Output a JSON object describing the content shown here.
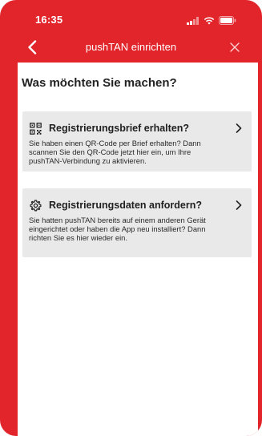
{
  "status_bar": {
    "time": "16:35",
    "icons": [
      "signal-icon",
      "wifi-icon",
      "battery-icon"
    ]
  },
  "nav": {
    "title": "pushTAN einrichten",
    "back_icon": "chevron-left-icon",
    "close_icon": "close-icon"
  },
  "main": {
    "heading": "Was möchten Sie machen?",
    "options": [
      {
        "icon": "qr-code-icon",
        "title": "Registrierungsbrief erhalten?",
        "lines": [
          "Sie haben einen QR-Code per Brief erhalten? Dann",
          "scannen Sie den QR-Code jetzt hier ein, um Ihre",
          "pushTAN-Verbindung zu aktivieren."
        ],
        "chevron": "chevron-right-icon"
      },
      {
        "icon": "gear-icon",
        "title": "Registrierungsdaten anfordern?",
        "lines": [
          "Sie hatten pushTAN bereits auf einem anderen Gerät",
          "eingerichtet oder haben die App neu installiert? Dann",
          "richten Sie es hier wieder ein."
        ],
        "chevron": "chevron-right-icon"
      }
    ]
  },
  "colors": {
    "brand_red": "#e2242b",
    "card_background": "#e9e9e9",
    "text": "#222222",
    "white": "#ffffff"
  }
}
